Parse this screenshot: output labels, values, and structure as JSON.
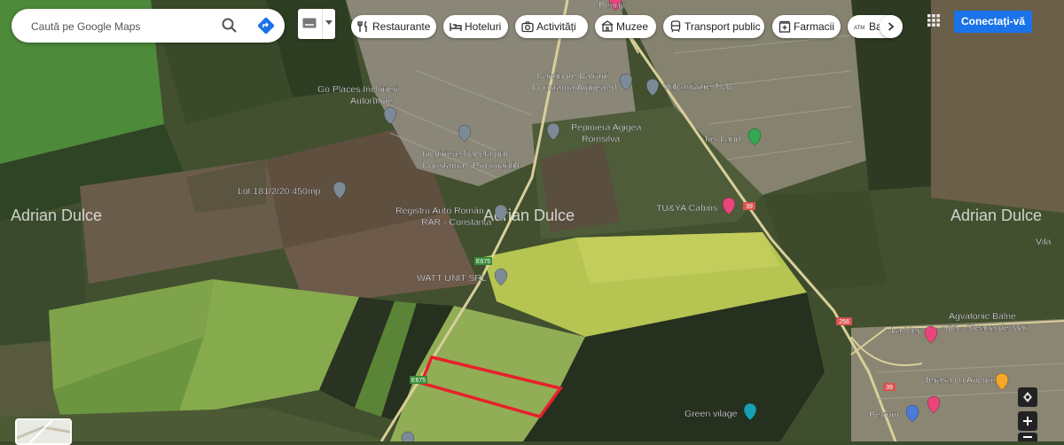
{
  "search": {
    "placeholder": "Caută pe Google Maps"
  },
  "chips": [
    {
      "label": "Restaurante",
      "icon": "restaurant-icon"
    },
    {
      "label": "Hoteluri",
      "icon": "hotel-icon"
    },
    {
      "label": "Activități",
      "icon": "camera-icon"
    },
    {
      "label": "Muzee",
      "icon": "museum-icon"
    },
    {
      "label": "Transport public",
      "icon": "train-icon"
    },
    {
      "label": "Farmacii",
      "icon": "pharmacy-icon"
    },
    {
      "label": "Ba",
      "icon": "atm-icon"
    }
  ],
  "header": {
    "signin_label": "Conectați-vă"
  },
  "watermarks": {
    "left": "Adrian Dulce",
    "center": "Adrian Dulce",
    "right": "Adrian Dulce"
  },
  "places": {
    "penny": "Penny",
    "camin_line1": "Camin de Batrani",
    "camin_line2": "Constanta Agigea Sf.",
    "vulcanizare": "Vulcanizare T&B",
    "go_places_line1": "Go Places Inchirieri",
    "go_places_line2": "Autorulote",
    "pepiniera_line1": "Pepiniera Agigea",
    "pepiniera_line2": "Romsilva",
    "iris_land": "Iris Land",
    "nacela_line1": "Inchiriere Nacela prb",
    "nacela_line2": "Constanta - Prosmartlift",
    "lot": "Lot 181/2/20 450mp",
    "registru_line1": "Registru Auto Român",
    "registru_line2": "RAR - Constanța",
    "tuya": "TU&YA Cabins",
    "watt": "WATT UNIT SRL",
    "agvatonic_line1": "Agvatonic Balne",
    "agvatonic_line2": "Spa · Steaua de Mar",
    "la_mer": "La Mer",
    "terasa": "Terasa cu Ancore",
    "petrom": "Petrom",
    "green_village": "Green vilage",
    "vila": "Vila"
  },
  "road_labels": {
    "e675_a": "E675",
    "e675_b": "E675",
    "r39": "39",
    "r256": "256",
    "r39b": "39"
  },
  "colors": {
    "brand_blue": "#1a73e8",
    "parcel_outline": "#e8202a",
    "pin_gray": "#7c8a97",
    "pin_pink": "#e8457b",
    "pin_green": "#33a852",
    "pin_teal": "#19a0b5"
  }
}
